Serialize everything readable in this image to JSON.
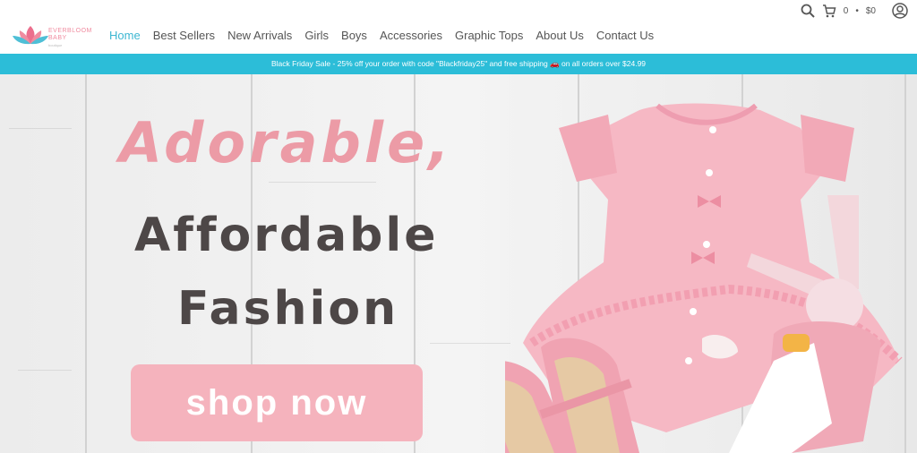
{
  "brand": {
    "name_line1": "EVERBLOOM",
    "name_line2": "BABY",
    "tagline": "boutique"
  },
  "nav": {
    "items": [
      {
        "label": "Home",
        "active": true
      },
      {
        "label": "Best Sellers"
      },
      {
        "label": "New Arrivals"
      },
      {
        "label": "Girls"
      },
      {
        "label": "Boys"
      },
      {
        "label": "Accessories"
      },
      {
        "label": "Graphic Tops"
      },
      {
        "label": "About Us"
      },
      {
        "label": "Contact Us"
      }
    ]
  },
  "header_icons": {
    "search": "search-icon",
    "cart": "cart-icon",
    "account": "user-icon"
  },
  "cart": {
    "count": "0",
    "separator": "•",
    "total": "$0"
  },
  "banner": {
    "text": "Black Friday Sale - 25% off your order with code \"Blackfriday25\" and free shipping 🚗 on all orders over $24.99"
  },
  "hero": {
    "headline_1": "Adorable,",
    "headline_2": "Affordable",
    "headline_3": "Fashion",
    "cta_label": "shop now"
  },
  "colors": {
    "accent": "#2cbdd8",
    "nav_active": "#3db7d2",
    "headline_pink": "#ec9ba6",
    "headline_dark": "#4d4747",
    "button": "#f5b3bd"
  }
}
